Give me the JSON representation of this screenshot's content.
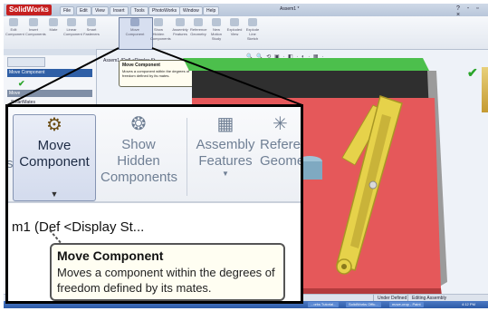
{
  "app": {
    "logo": "SolidWorks",
    "doc_title": "Assem1 *",
    "window_controls": "? - ▫ ×"
  },
  "menus": [
    "File",
    "Edit",
    "View",
    "Insert",
    "Tools",
    "PhotoWorks",
    "Window",
    "Help"
  ],
  "ribbon_small": [
    "Edit Component",
    "Insert Components",
    "Mate",
    "Linear Component",
    "Smart Fasteners",
    "Move Component",
    "Show Hidden Components",
    "Assembly Features",
    "Reference Geometry",
    "New Motion Study",
    "Exploded View",
    "Explode Line Sketch"
  ],
  "left_panel": {
    "header": "Move Component",
    "move_box": "Move",
    "smart_mates": "SmartMates"
  },
  "tree_item_small": "Assem1 (Def)  <Display St...",
  "tooltip": {
    "title": "Move Component",
    "text": "Moves a component within the degrees of freedom defined by its mates."
  },
  "zoom": {
    "left_fragment": "s",
    "tools": {
      "move_component": "Move Component",
      "show_hidden": "Show Hidden Components",
      "assembly_features": "Assembly Features",
      "reference_geometry": "Reference Geome"
    },
    "tree_item": "m1  (Def   <Display St..."
  },
  "status_bar": {
    "items": [
      "Under Defined",
      "Editing Assembly"
    ]
  },
  "taskbar": [
    "...orks Tutorial...",
    "SolidWorks Offic...",
    "move-crop - Paint"
  ],
  "clock": "4:12 PM",
  "colors": {
    "accent_red": "#c62020",
    "model_plate": "#e5585a",
    "model_arm": "#e6d24a",
    "confirm_green": "#2aa52a"
  }
}
